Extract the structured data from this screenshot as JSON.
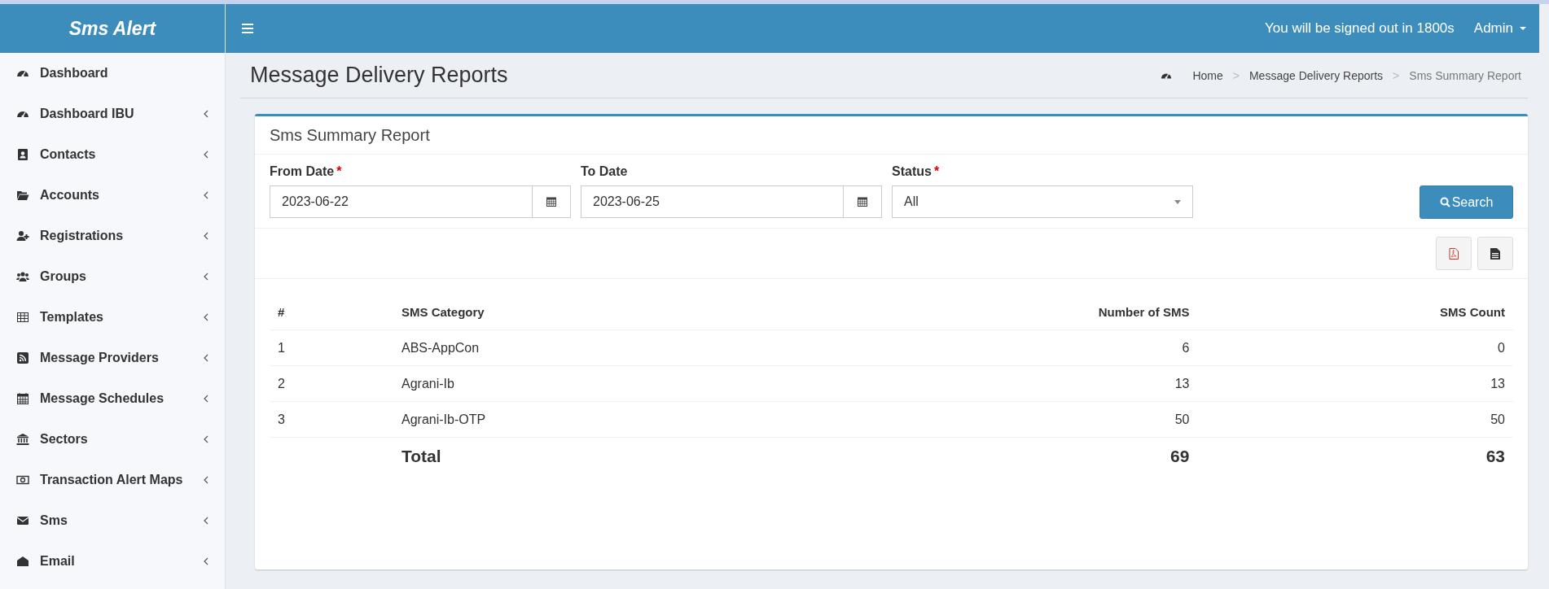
{
  "app": {
    "title": "Sms Alert"
  },
  "header": {
    "session_notice": "You will be signed out in 1800s",
    "user": "Admin"
  },
  "sidebar": {
    "items": [
      {
        "label": "Dashboard",
        "expandable": false
      },
      {
        "label": "Dashboard IBU",
        "expandable": true
      },
      {
        "label": "Contacts",
        "expandable": true
      },
      {
        "label": "Accounts",
        "expandable": true
      },
      {
        "label": "Registrations",
        "expandable": true
      },
      {
        "label": "Groups",
        "expandable": true
      },
      {
        "label": "Templates",
        "expandable": true
      },
      {
        "label": "Message Providers",
        "expandable": true
      },
      {
        "label": "Message Schedules",
        "expandable": true
      },
      {
        "label": "Sectors",
        "expandable": true
      },
      {
        "label": "Transaction Alert Maps",
        "expandable": true
      },
      {
        "label": "Sms",
        "expandable": true
      },
      {
        "label": "Email",
        "expandable": true
      }
    ]
  },
  "page": {
    "title": "Message Delivery Reports",
    "breadcrumb": [
      {
        "label": "Home",
        "current": false
      },
      {
        "separator": ">",
        "label": "Message Delivery Reports",
        "current": false
      },
      {
        "separator": ">",
        "label": "Sms Summary Report",
        "current": true
      }
    ]
  },
  "card": {
    "title": "Sms Summary Report",
    "filters": [
      {
        "kind": "date",
        "label": "From Date",
        "required_mark": "*",
        "value": "2023-06-22"
      },
      {
        "kind": "date",
        "label": "To Date",
        "value": "2023-06-25"
      },
      {
        "kind": "select",
        "label": "Status",
        "required_mark": "*",
        "value": "All"
      }
    ],
    "search_button": "Search",
    "table": {
      "columns": [
        "#",
        "SMS Category",
        "Number of SMS",
        "SMS Count"
      ],
      "rows": [
        [
          "1",
          "ABS-AppCon",
          "6",
          "0"
        ],
        [
          "2",
          "Agrani-Ib",
          "13",
          "13"
        ],
        [
          "3",
          "Agrani-Ib-OTP",
          "50",
          "50"
        ]
      ],
      "total": {
        "label": "Total",
        "number_of_sms": "69",
        "sms_count": "63"
      }
    }
  }
}
